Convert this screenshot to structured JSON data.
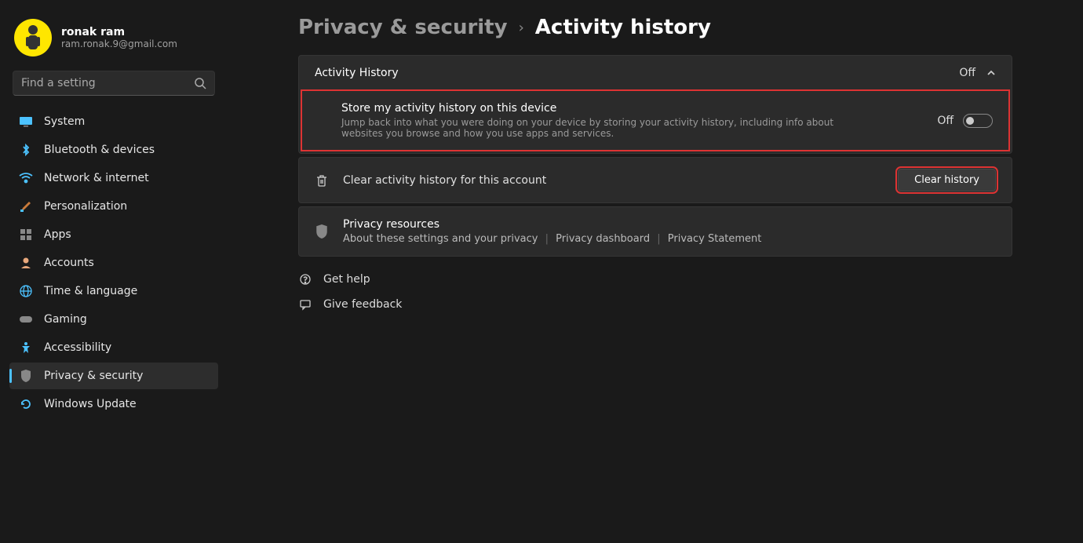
{
  "user": {
    "name": "ronak ram",
    "email": "ram.ronak.9@gmail.com"
  },
  "search": {
    "placeholder": "Find a setting"
  },
  "sidebar": {
    "items": [
      {
        "label": "System",
        "icon": "💻"
      },
      {
        "label": "Bluetooth & devices",
        "icon": "bt"
      },
      {
        "label": "Network & internet",
        "icon": "📶"
      },
      {
        "label": "Personalization",
        "icon": "🖌️"
      },
      {
        "label": "Apps",
        "icon": "▦"
      },
      {
        "label": "Accounts",
        "icon": "👤"
      },
      {
        "label": "Time & language",
        "icon": "🌐"
      },
      {
        "label": "Gaming",
        "icon": "🎮"
      },
      {
        "label": "Accessibility",
        "icon": "acc"
      },
      {
        "label": "Privacy & security",
        "icon": "🛡"
      },
      {
        "label": "Windows Update",
        "icon": "🔄"
      }
    ]
  },
  "breadcrumb": {
    "parent": "Privacy & security",
    "current": "Activity history"
  },
  "main": {
    "card_title": "Activity History",
    "card_status": "Off",
    "store_title": "Store my activity history on this device",
    "store_desc": "Jump back into what you were doing on your device by storing your activity history, including info about websites you browse and how you use apps and services.",
    "store_state": "Off",
    "clear_label": "Clear activity history for this account",
    "clear_button": "Clear history",
    "resources_title": "Privacy resources",
    "resources_links": [
      "About these settings and your privacy",
      "Privacy dashboard",
      "Privacy Statement"
    ]
  },
  "help": {
    "get_help": "Get help",
    "feedback": "Give feedback"
  }
}
